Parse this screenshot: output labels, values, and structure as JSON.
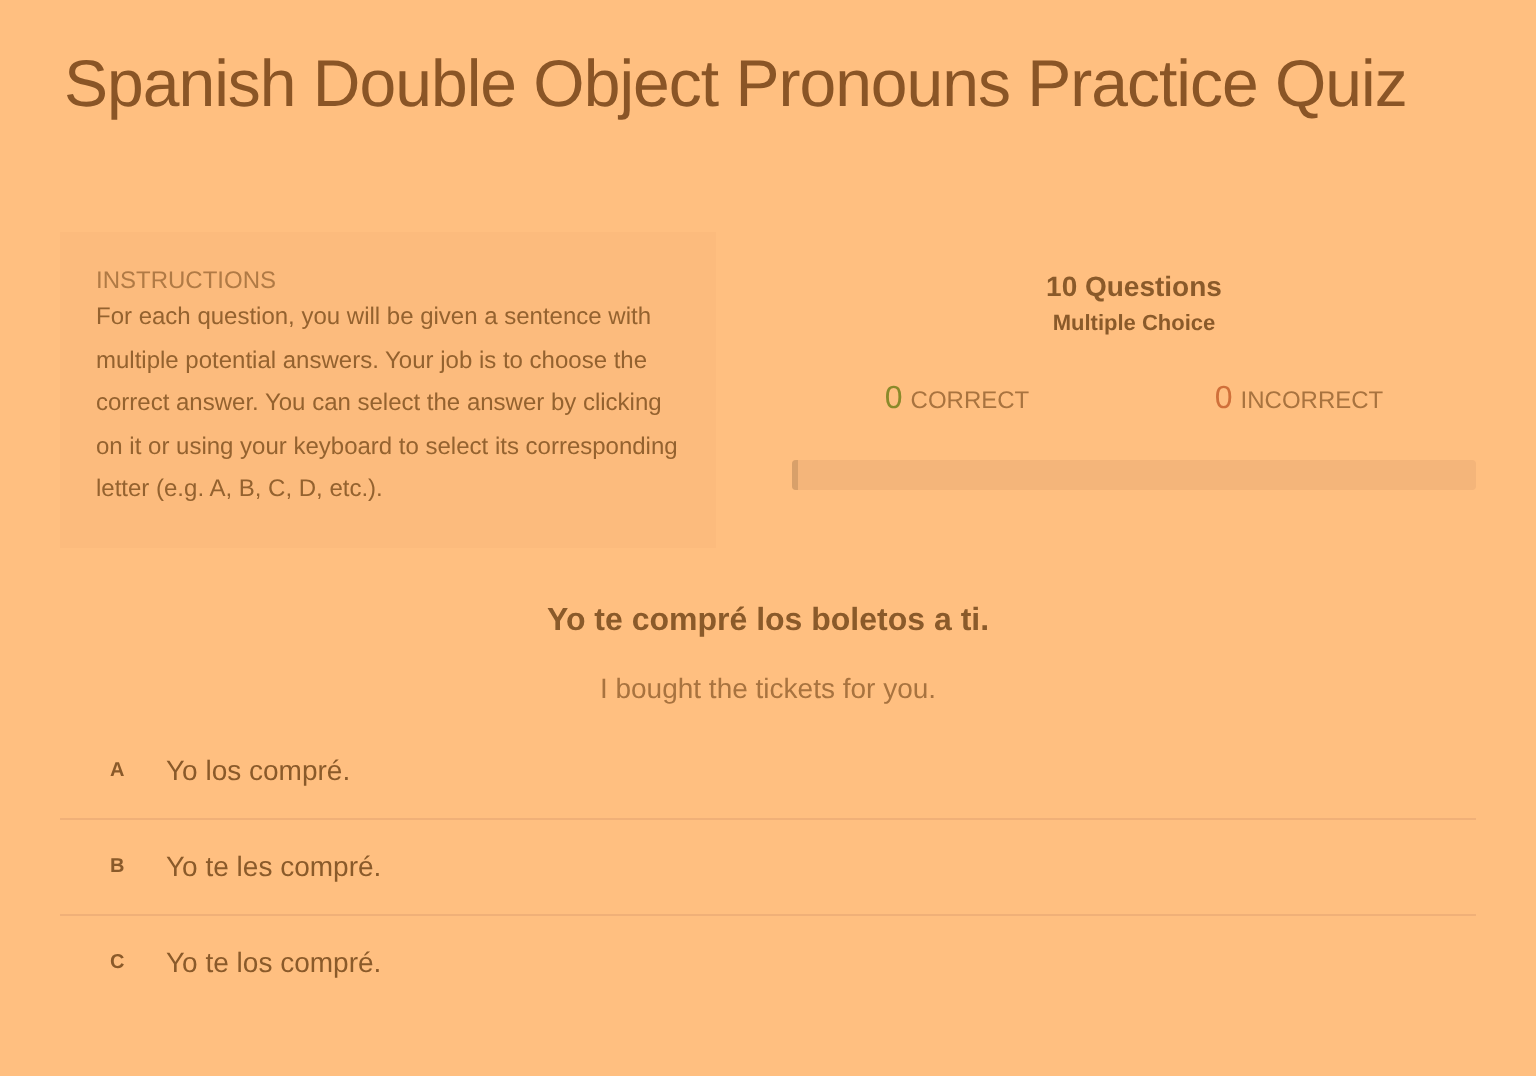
{
  "title": "Spanish Double Object Pronouns Practice Quiz",
  "instructions": {
    "heading": "INSTRUCTIONS",
    "text": "For each question, you will be given a sentence with multiple potential answers. Your job is to choose the correct answer. You can select the answer by clicking on it or using your keyboard to select its corresponding letter (e.g. A, B, C, D, etc.)."
  },
  "summary": {
    "count": "10 Questions",
    "type": "Multiple Choice",
    "correct_count": "0",
    "correct_label": "CORRECT",
    "incorrect_count": "0",
    "incorrect_label": "INCORRECT",
    "progress": {
      "level": 0.01
    }
  },
  "question": {
    "sentence": "Yo te compré los boletos a ti.",
    "translation": "I bought the tickets for you.",
    "answers": [
      {
        "letter": "A",
        "text": "Yo los compré."
      },
      {
        "letter": "B",
        "text": "Yo te les compré."
      },
      {
        "letter": "C",
        "text": "Yo te los compré."
      }
    ]
  }
}
